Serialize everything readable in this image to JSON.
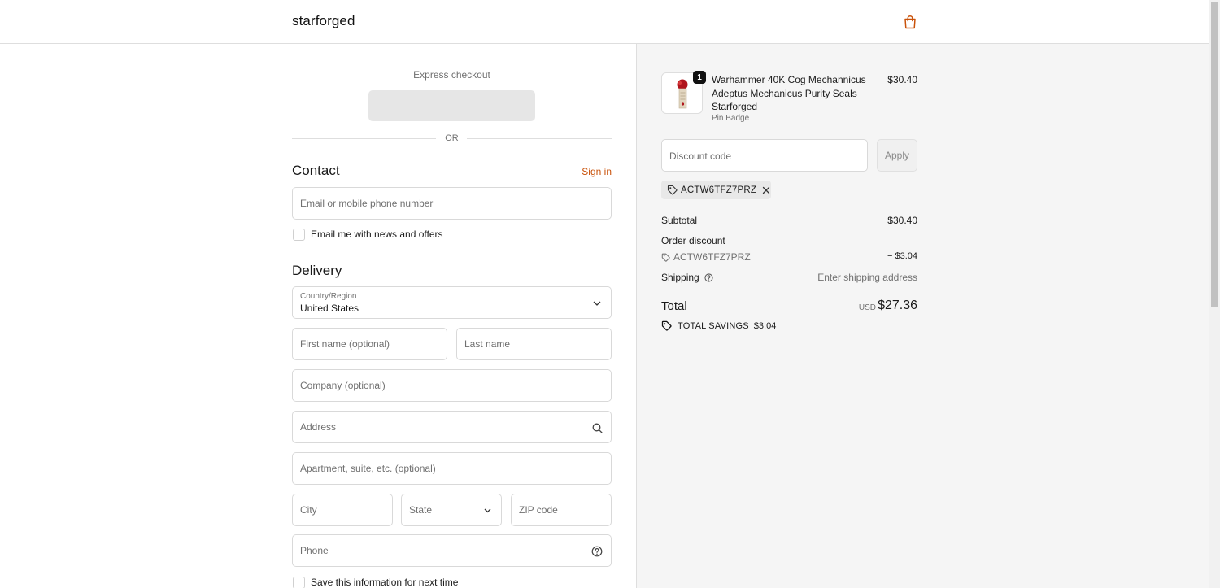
{
  "header": {
    "brand": "starforged",
    "cart_icon": "shopping-bag-icon",
    "accent": "#c9520a"
  },
  "express": {
    "title": "Express checkout",
    "divider": "OR"
  },
  "contact": {
    "title": "Contact",
    "sign_in": "Sign in",
    "email_placeholder": "Email or mobile phone number",
    "news_label": "Email me with news and offers",
    "news_checked": false
  },
  "delivery": {
    "title": "Delivery",
    "country_label": "Country/Region",
    "country_value": "United States",
    "first_name": "First name (optional)",
    "last_name": "Last name",
    "company": "Company (optional)",
    "address": "Address",
    "apartment": "Apartment, suite, etc. (optional)",
    "city": "City",
    "state": "State",
    "zip": "ZIP code",
    "phone": "Phone",
    "save_label": "Save this information for next time",
    "save_checked": false
  },
  "order": {
    "product": {
      "name": "Warhammer 40K Cog Mechannicus Adeptus Mechanicus Purity Seals Starforged",
      "variant": "Pin Badge",
      "price": "$30.40",
      "quantity": "1"
    },
    "discount_placeholder": "Discount code",
    "apply_label": "Apply",
    "applied_code": "ACTW6TFZ7PRZ",
    "subtotal_label": "Subtotal",
    "subtotal_value": "$30.40",
    "order_discount_label": "Order discount",
    "discount_code": "ACTW6TFZ7PRZ",
    "discount_value": "− $3.04",
    "shipping_label": "Shipping",
    "shipping_value": "Enter shipping address",
    "total_label": "Total",
    "currency": "USD",
    "total_value": "$27.36",
    "savings_label": "TOTAL SAVINGS",
    "savings_value": "$3.04"
  }
}
